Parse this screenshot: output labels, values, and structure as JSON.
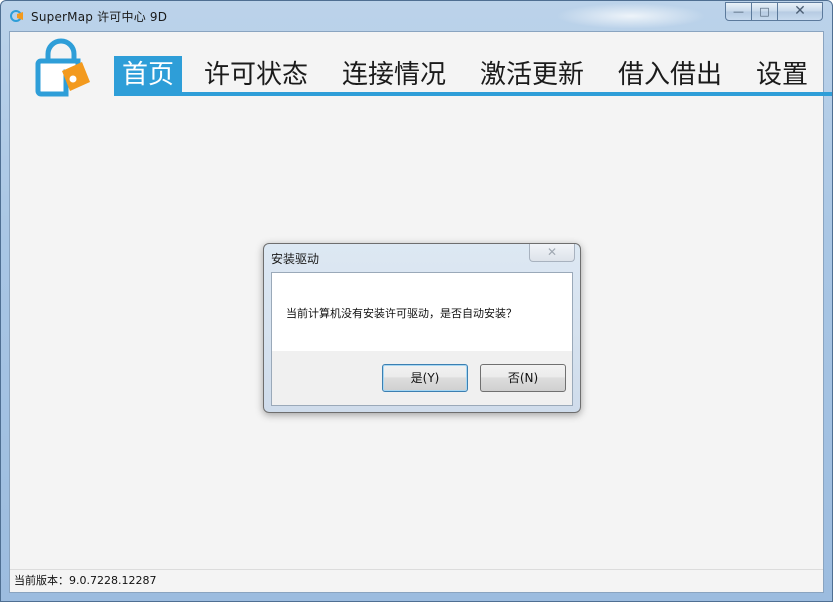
{
  "window": {
    "title": "SuperMap 许可中心 9D",
    "controls": {
      "minimize": "—",
      "maximize": "□",
      "close": "✕"
    }
  },
  "nav": {
    "items": [
      {
        "label": "首页",
        "active": true
      },
      {
        "label": "许可状态",
        "active": false
      },
      {
        "label": "连接情况",
        "active": false
      },
      {
        "label": "激活更新",
        "active": false
      },
      {
        "label": "借入借出",
        "active": false
      },
      {
        "label": "设置",
        "active": false
      }
    ]
  },
  "status_bar": {
    "version_text": "当前版本：9.0.7228.12287"
  },
  "dialog": {
    "title": "安装驱动",
    "close": "✕",
    "message": "当前计算机没有安装许可驱动，是否自动安装？",
    "yes_label": "是(Y)",
    "no_label": "否(N)"
  },
  "colors": {
    "accent": "#2e9ed8",
    "logo_orange": "#f39a1e"
  },
  "icons": {
    "app": "supermap-app-icon",
    "logo": "license-lock-key-logo"
  }
}
